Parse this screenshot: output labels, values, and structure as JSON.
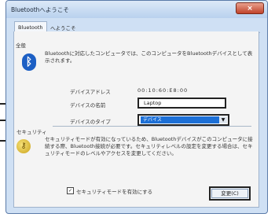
{
  "window": {
    "title": "Bluetoothへようこそ",
    "close_icon": "x-close-icon"
  },
  "tabs": [
    {
      "label": "Bluetooth"
    }
  ],
  "tab_extra": "へようこそ",
  "general": {
    "label": "全般",
    "icon": "bluetooth-icon",
    "description": "Bluetoothに対応したコンピュータでは、このコンピュータをBluetoothデバイスとして表示されます。",
    "address_label": "デバイスアドレス",
    "address_value": "00:10:60:E8:00",
    "name_label": "デバイスの名前",
    "name_value": "Laptop",
    "type_label": "デバイスのタイプ",
    "type_value": "デバイス"
  },
  "security": {
    "label": "セキュリティ",
    "icon": "key-icon",
    "text": "セキュリティモードが有効になっているため、Bluetoothデバイスがこのコンピュータに接続する際、Bluetooth接続が必要です。セキュリティレベルの設定を変更する場合は、セキュリティモードのレベルやアクセスを変更してください。",
    "checkbox_label": "セキュリティモードを有効にする",
    "checkbox_checked": true,
    "change_button": "変更(C)"
  }
}
